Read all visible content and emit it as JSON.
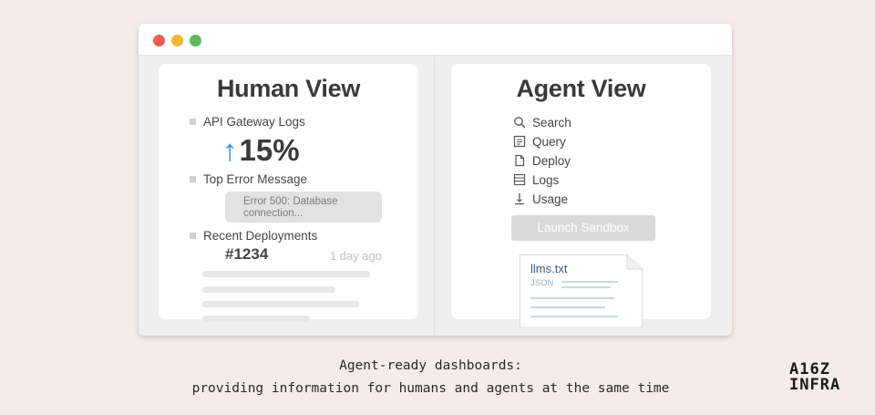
{
  "window": {
    "traffic_lights": {
      "close_color": "#ef5b4c",
      "minimize_color": "#f2b632",
      "maximize_color": "#5cb85c"
    }
  },
  "human_view": {
    "title": "Human View",
    "api_logs_label": "API Gateway Logs",
    "metric_arrow": "↑",
    "metric_value": "15%",
    "metric_arrow_color": "#2f8fd8",
    "top_error_label": "Top Error Message",
    "error_line1": "Error 500: Database",
    "error_line2": "connection...",
    "recent_deployments_label": "Recent Deployments",
    "deployment_id": "#1234",
    "deployment_time": "1 day ago"
  },
  "agent_view": {
    "title": "Agent View",
    "items": [
      {
        "label": "Search",
        "icon": "search-icon"
      },
      {
        "label": "Query",
        "icon": "query-icon"
      },
      {
        "label": "Deploy",
        "icon": "document-icon"
      },
      {
        "label": "Logs",
        "icon": "logs-icon"
      },
      {
        "label": "Usage",
        "icon": "usage-icon"
      }
    ],
    "launch_button": "Launch Sandbox",
    "file_name": "llms.txt",
    "file_type": "JSON"
  },
  "caption": {
    "line1": "Agent-ready dashboards:",
    "line2": "providing information for humans and agents at the same time"
  },
  "logo": {
    "line1": "A16Z",
    "line2": "INFRA"
  }
}
